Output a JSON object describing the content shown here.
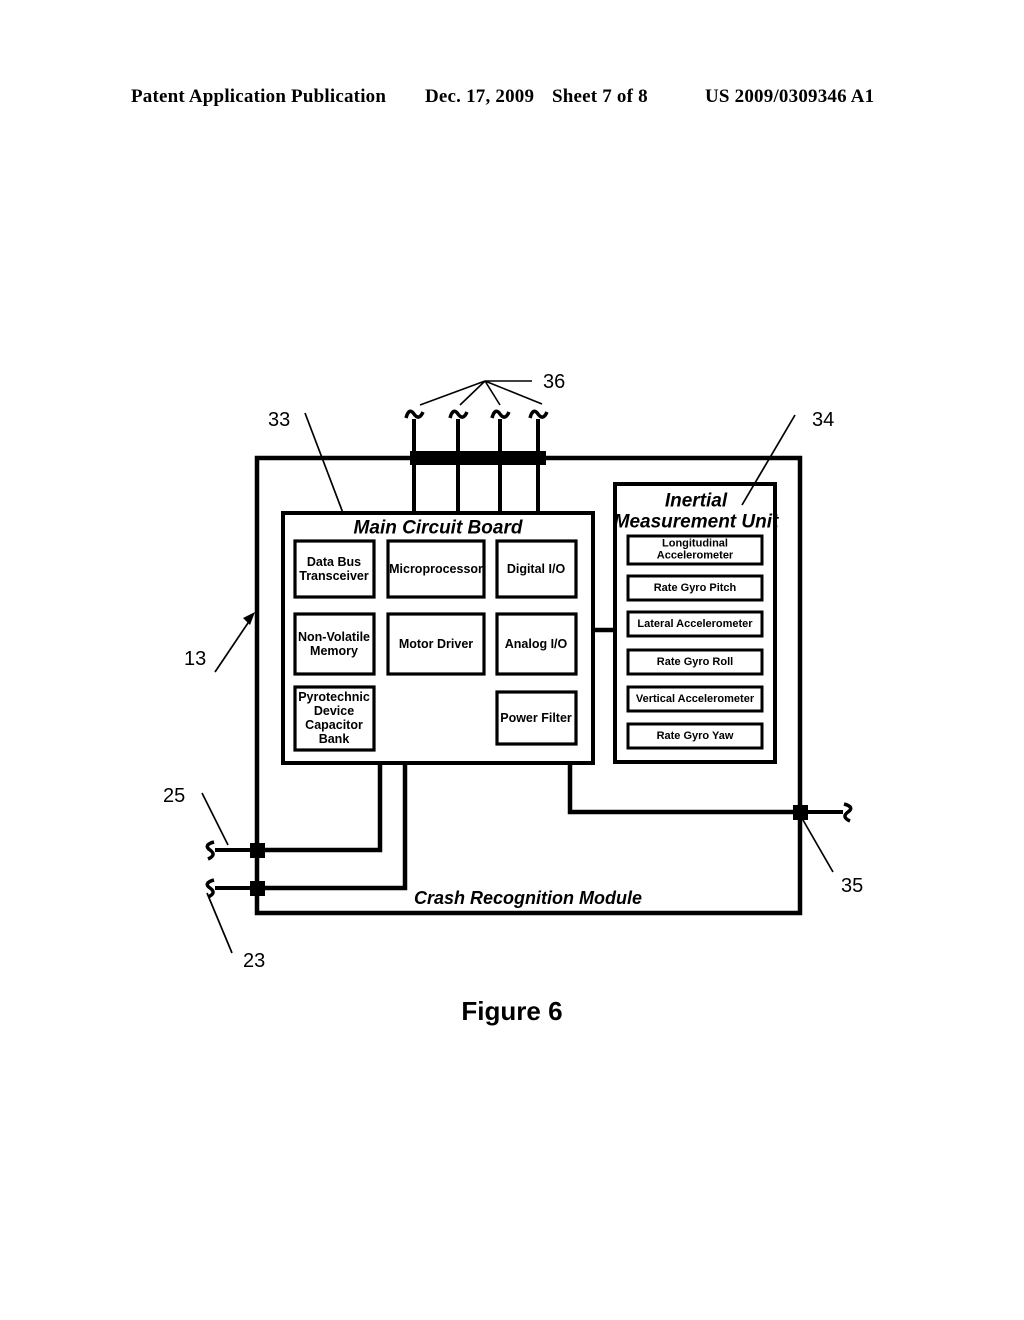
{
  "header": {
    "publication": "Patent Application Publication",
    "date": "Dec. 17, 2009",
    "sheet": "Sheet 7 of 8",
    "patent_number": "US 2009/0309346 A1"
  },
  "figure": {
    "caption": "Figure 6",
    "module_title": "Crash Recognition Module"
  },
  "main_circuit_board": {
    "title": "Main Circuit Board",
    "blocks": [
      {
        "id": "data-bus-transceiver",
        "label": "Data Bus\nTransceiver"
      },
      {
        "id": "microprocessor",
        "label": "Microprocessor"
      },
      {
        "id": "digital-io",
        "label": "Digital I/O"
      },
      {
        "id": "non-volatile-memory",
        "label": "Non-Volatile\nMemory"
      },
      {
        "id": "motor-driver",
        "label": "Motor Driver"
      },
      {
        "id": "analog-io",
        "label": "Analog I/O"
      },
      {
        "id": "pyrotechnic-capacitor-bank",
        "label": "Pyrotechnic\nDevice\nCapacitor\nBank"
      },
      {
        "id": "power-filter",
        "label": "Power Filter"
      }
    ]
  },
  "inertial_measurement_unit": {
    "title": "Inertial\nMeasurement Unit",
    "title_line1": "Inertial",
    "title_line2": "Measurement Unit",
    "sensors": [
      {
        "id": "longitudinal-accelerometer",
        "label": "Longitudinal\nAccelerometer"
      },
      {
        "id": "rate-gyro-pitch",
        "label": "Rate Gyro Pitch"
      },
      {
        "id": "lateral-accelerometer",
        "label": "Lateral Accelerometer"
      },
      {
        "id": "rate-gyro-roll",
        "label": "Rate Gyro Roll"
      },
      {
        "id": "vertical-accelerometer",
        "label": "Vertical Accelerometer"
      },
      {
        "id": "rate-gyro-yaw",
        "label": "Rate Gyro Yaw"
      }
    ]
  },
  "reference_numerals": {
    "module": "13",
    "main_board": "33",
    "imu": "34",
    "top_harness": "36",
    "right_wire": "35",
    "left_wire_upper": "25",
    "left_wire_lower": "23"
  },
  "colors": {
    "line": "#000000",
    "background": "#ffffff"
  }
}
